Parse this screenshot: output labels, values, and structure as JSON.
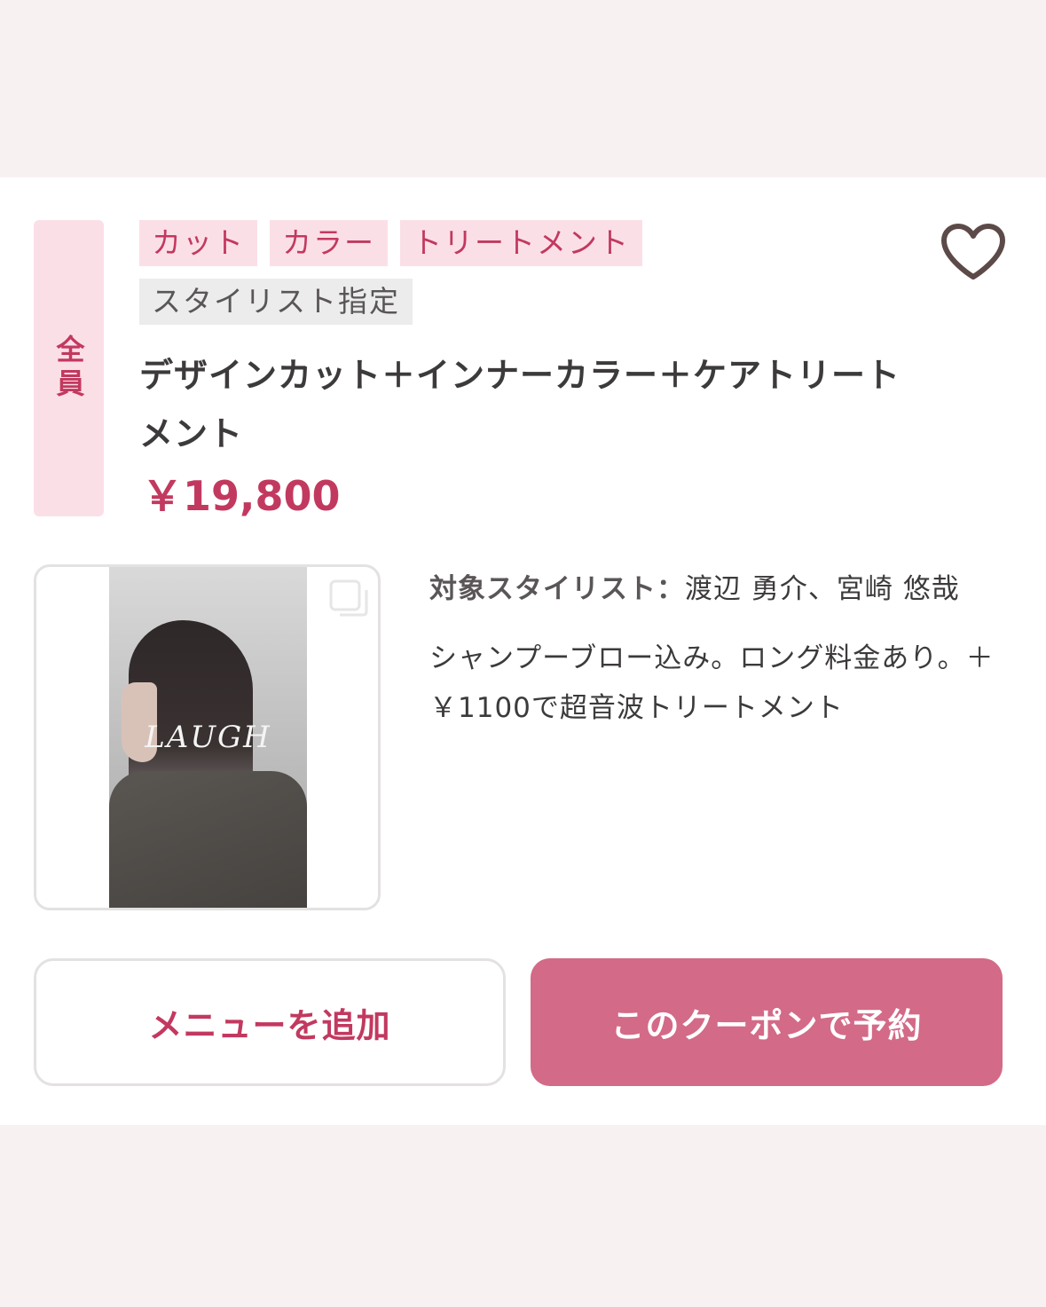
{
  "coupon": {
    "audience_badge": "全員",
    "tags_row1": [
      "カット",
      "カラー",
      "トリートメント"
    ],
    "tags_row2": [
      "スタイリスト指定"
    ],
    "title": "デザインカット＋インナーカラー＋ケアトリートメント",
    "price": "￥19,800",
    "image_watermark": "LAUGH",
    "stylist_label": "対象スタイリスト：",
    "stylist_names": "渡辺 勇介、宮崎 悠哉",
    "description": "シャンプーブロー込み。ロング料金あり。＋￥1100で超音波トリートメント",
    "add_menu_label": "メニューを追加",
    "book_label": "このクーポンで予約"
  },
  "colors": {
    "accent": "#c2395f",
    "tag_bg": "#fbdfe7",
    "book_button": "#d36a87",
    "page_bg": "#f8f1f2"
  },
  "icons": [
    "heart-icon",
    "multiple-images-icon"
  ]
}
